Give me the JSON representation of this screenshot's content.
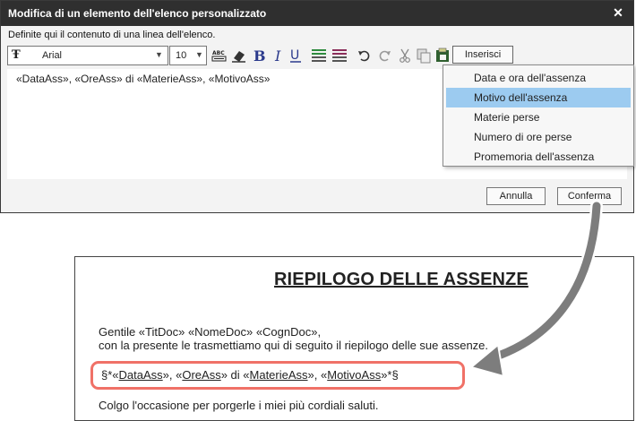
{
  "dialog": {
    "title": "Modifica di un elemento dell'elenco personalizzato",
    "close_glyph": "✕",
    "instruction": "Definite qui il contenuto di una linea dell'elenco.",
    "toolbar": {
      "font_icon_glyph": "Ŧ",
      "font_name": "Arial",
      "font_size": "10",
      "dropdown_glyph": "▼",
      "insert_label": "Inserisci",
      "icons": [
        "abc-icon",
        "eraser-icon",
        "bold-icon",
        "italic-icon",
        "underline-icon",
        "text-color-icon",
        "highlight-color-icon",
        "undo-icon",
        "redo-icon",
        "cut-icon",
        "copy-icon",
        "paste-icon"
      ]
    },
    "editor_text": "«DataAss», «OreAss» di «MaterieAss», «MotivoAss»",
    "buttons": {
      "cancel": "Annulla",
      "confirm": "Conferma"
    }
  },
  "insert_menu": {
    "items": [
      {
        "label": "Data e ora dell'assenza",
        "selected": false
      },
      {
        "label": "Motivo dell'assenza",
        "selected": true
      },
      {
        "label": "Materie perse",
        "selected": false
      },
      {
        "label": "Numero di ore perse",
        "selected": false
      },
      {
        "label": "Promemoria dell'assenza",
        "selected": false
      }
    ]
  },
  "document": {
    "title": "RIEPILOGO DELLE ASSENZE",
    "greeting": "Gentile «TitDoc» «NomeDoc» «CognDoc»,",
    "intro": "con la presente le trasmettiamo qui di seguito il riepilogo delle sue assenze.",
    "template_parts": [
      "§*«",
      "DataAss",
      "», «",
      "OreAss",
      "» di «",
      "MaterieAss",
      "», «",
      "MotivoAss",
      "»*§"
    ],
    "closing": "Colgo l'occasione per porgerle i miei più cordiali saluti."
  },
  "colors": {
    "titlebar": "#2f2f2f",
    "selected_item": "#9ccbf0",
    "highlight": "#f07167",
    "arrow": "#7d7d7d"
  }
}
